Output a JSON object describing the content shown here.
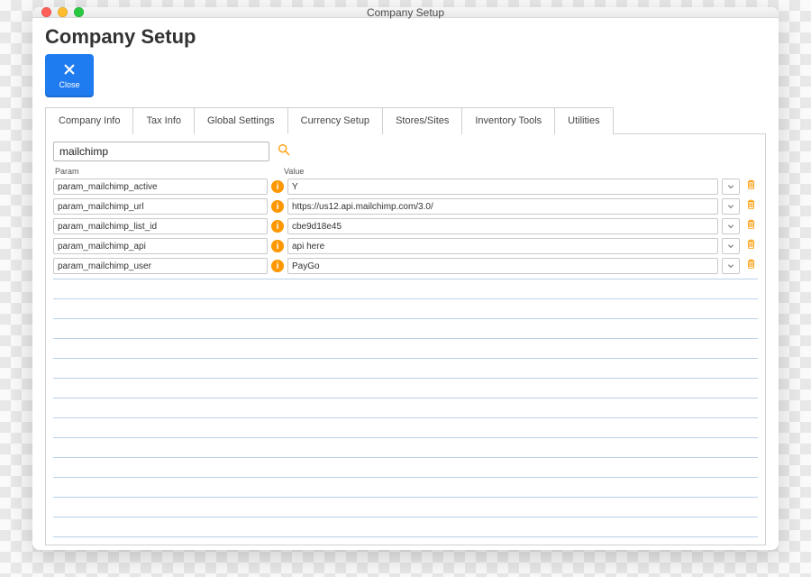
{
  "window": {
    "title": "Company Setup"
  },
  "page": {
    "title": "Company Setup"
  },
  "close": {
    "label": "Close"
  },
  "tabs": [
    {
      "label": "Company Info"
    },
    {
      "label": "Tax Info"
    },
    {
      "label": "Global Settings",
      "active": true
    },
    {
      "label": "Currency Setup"
    },
    {
      "label": "Stores/Sites"
    },
    {
      "label": "Inventory Tools"
    },
    {
      "label": "Utilities"
    }
  ],
  "search": {
    "value": "mailchimp"
  },
  "table": {
    "headers": {
      "param": "Param",
      "value": "Value"
    },
    "rows": [
      {
        "param": "param_mailchimp_active",
        "value": "Y"
      },
      {
        "param": "param_mailchimp_url",
        "value": "https://us12.api.mailchimp.com/3.0/"
      },
      {
        "param": "param_mailchimp_list_id",
        "value": "cbe9d18e45"
      },
      {
        "param": "param_mailchimp_api",
        "value": "api here"
      },
      {
        "param": "param_mailchimp_user",
        "value": "PayGo"
      }
    ]
  }
}
